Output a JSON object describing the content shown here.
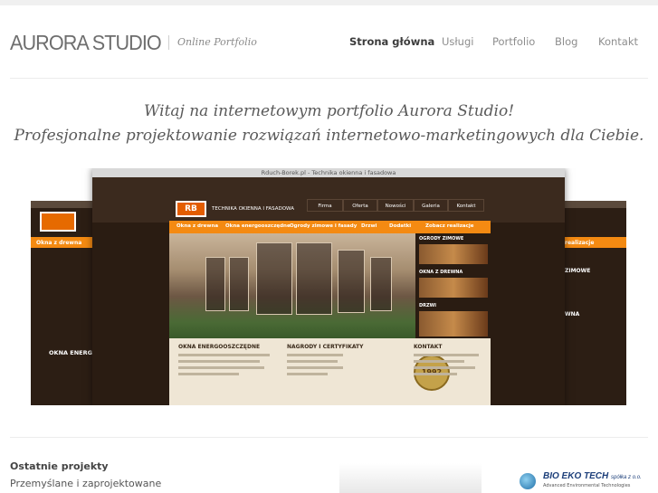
{
  "header": {
    "logo": "AURORA STUDIO",
    "tagline": "Online Portfolio",
    "nav": [
      {
        "label": "Strona główna",
        "active": true
      },
      {
        "label": "Usługi",
        "active": false
      },
      {
        "label": "Portfolio",
        "active": false
      },
      {
        "label": "Blog",
        "active": false
      },
      {
        "label": "Kontakt",
        "active": false
      }
    ]
  },
  "intro": {
    "line1": "Witaj na internetowym portfolio Aurora Studio!",
    "line2": "Profesjonalne projektowanie rozwiązań internetowo-marketingowych dla Ciebie."
  },
  "showcase": {
    "site_title": "Rduch-Borek.pl - Technika okienna i fasadowa",
    "site_tagline": "TECHNIKA OKIENNA I FASADOWA",
    "site_logo": "RB",
    "site_nav": [
      "Firma",
      "Oferta",
      "Nowości",
      "Galeria",
      "Kontakt"
    ],
    "site_menu": [
      "Okna z drewna",
      "Okna energooszczędne",
      "Ogrody zimowe i fasady",
      "Drzwi",
      "Dodatki",
      "Zobacz realizacje"
    ],
    "thumb_labels": [
      "OGRODY ZIMOWE",
      "OKNA Z DREWNA",
      "DRZWI"
    ],
    "columns": [
      {
        "heading": "OKNA ENERGOOSZCZĘDNE"
      },
      {
        "heading": "NAGRODY I CERTYFIKATY"
      },
      {
        "heading": "KONTAKT"
      }
    ],
    "badge": "1992",
    "left_menu": "Okna z drewna",
    "left_heading": "OKNA ENERGOO",
    "right_menu": "realizacje",
    "right_labels": [
      "ZIMOWE",
      "WNA"
    ]
  },
  "recent": {
    "title": "Ostatnie projekty",
    "subtitle": "Przemyślane i zaprojektowane"
  },
  "client": {
    "name": "BIO EKO TECH",
    "suffix": "spółka z o.o.",
    "subtitle": "Advanced Environmental Technologies"
  },
  "colors": {
    "accent_orange": "#f48a12",
    "dark_brown": "#2a1c12",
    "nav_active": "#3c3c3c",
    "nav_inactive": "#8d8d8d"
  }
}
